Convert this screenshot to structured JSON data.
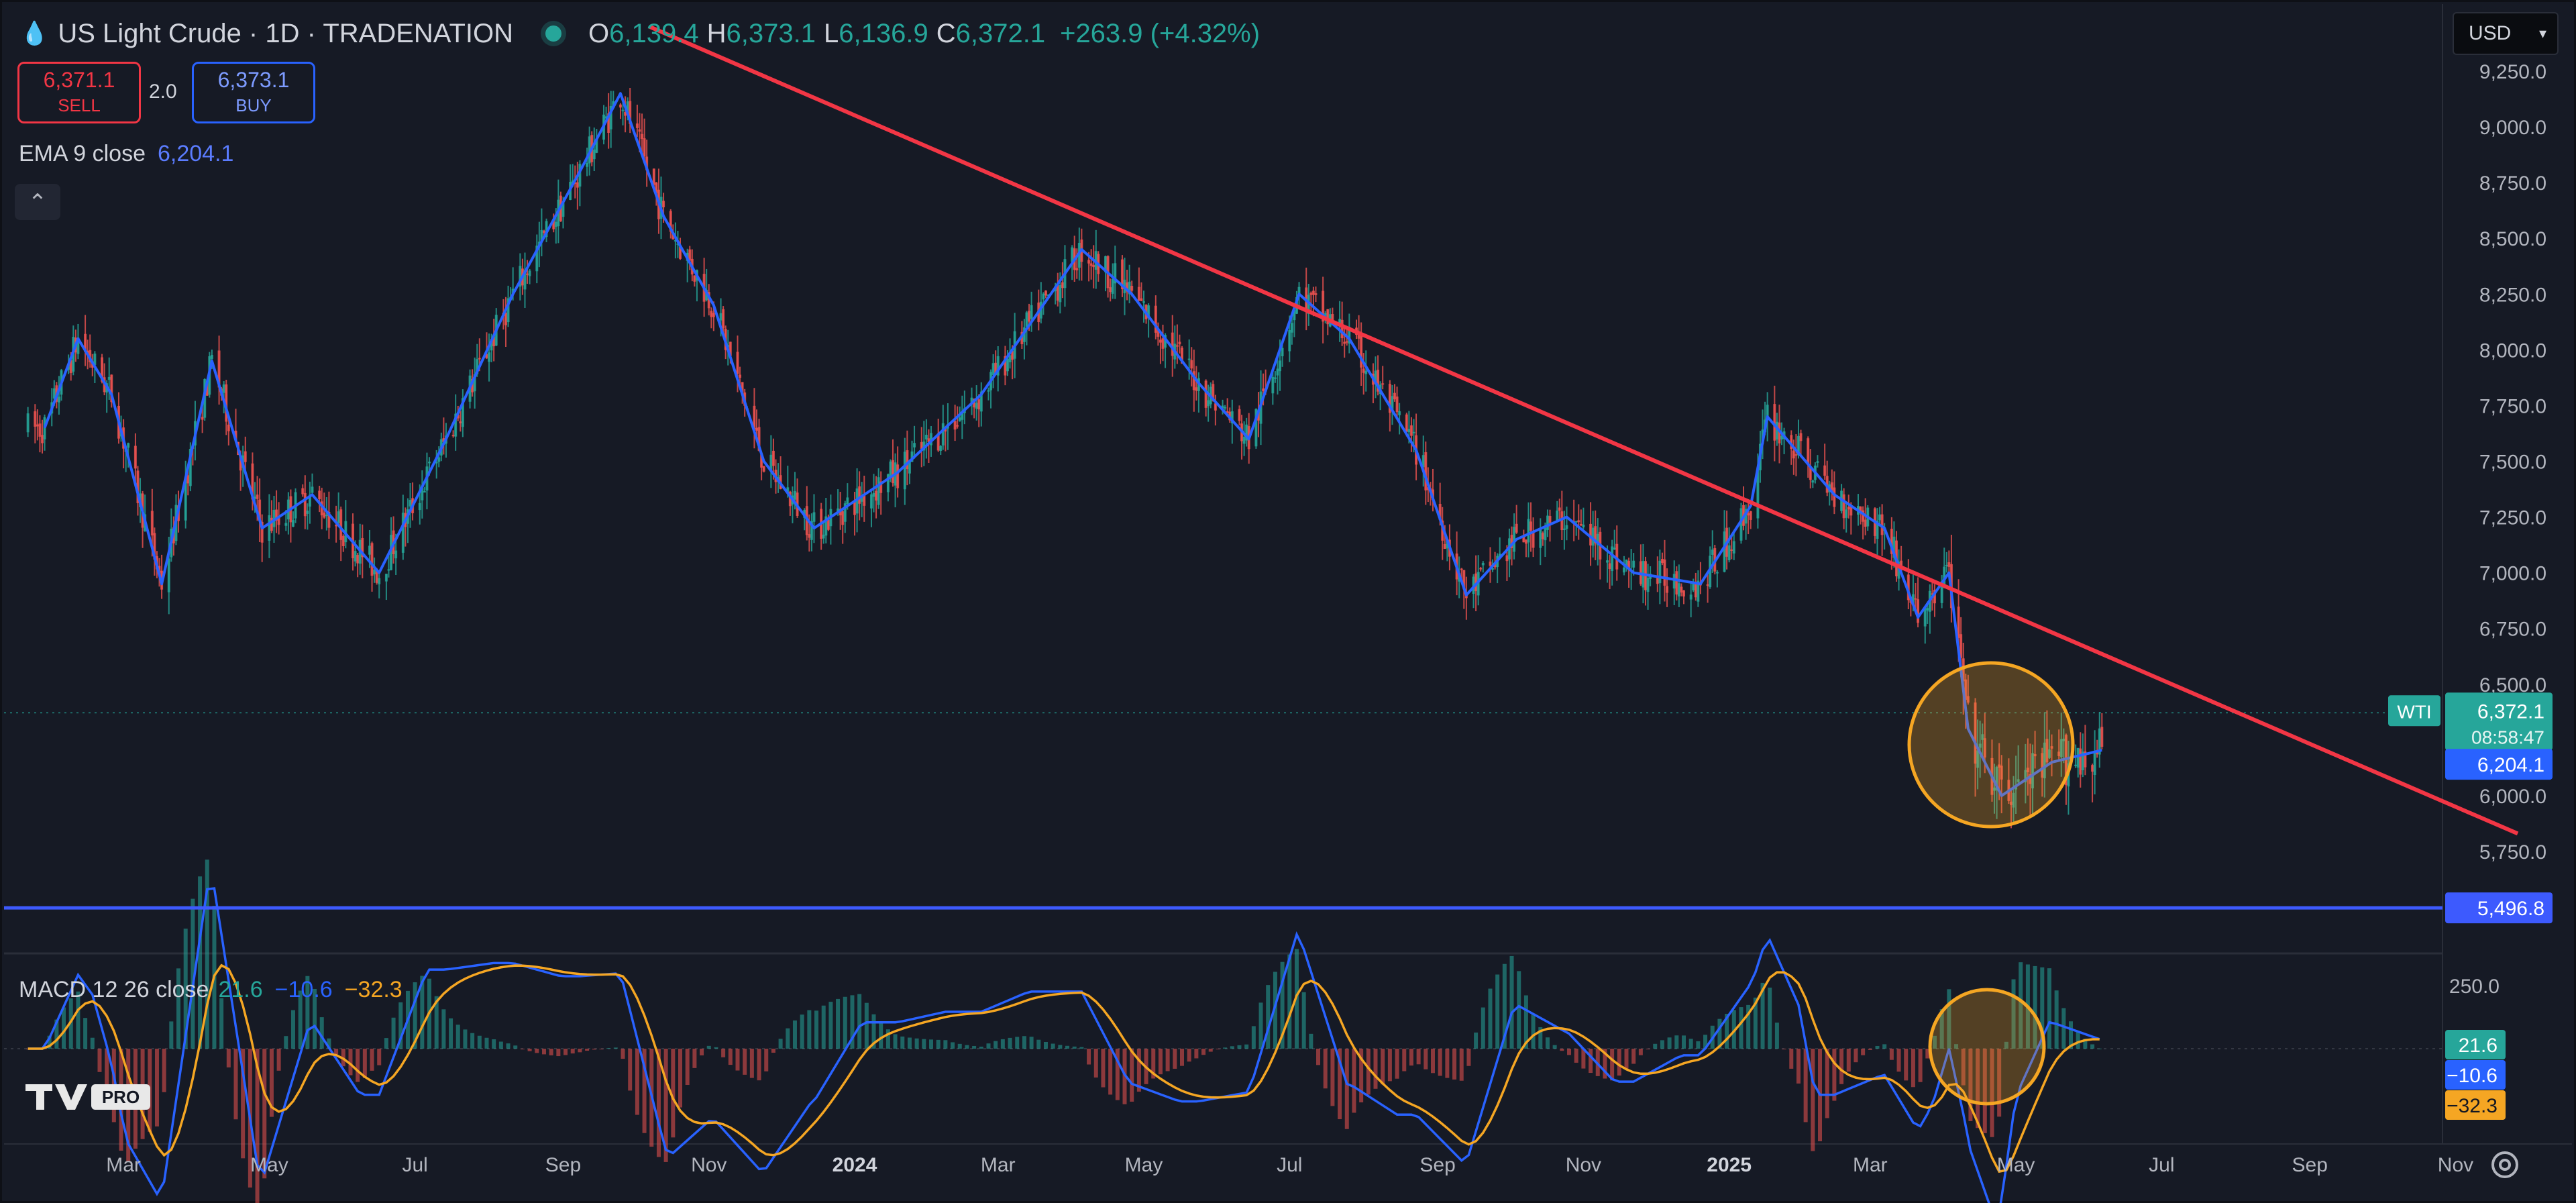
{
  "header": {
    "symbol": "US Light Crude · 1D · TRADENATION",
    "open_label": "O",
    "open": "6,139.4",
    "high_label": "H",
    "high": "6,373.1",
    "low_label": "L",
    "low": "6,136.9",
    "close_label": "C",
    "close": "6,372.1",
    "change": "+263.9 (+4.32%)"
  },
  "trade": {
    "sell_price": "6,371.1",
    "sell_label": "SELL",
    "quantity": "2.0",
    "buy_price": "6,373.1",
    "buy_label": "BUY"
  },
  "ema": {
    "label": "EMA 9 close",
    "value": "6,204.1"
  },
  "currency": "USD",
  "macd": {
    "label": "MACD 12 26 close",
    "macd": "21.6",
    "signal": "−10.6",
    "hist": "−32.3"
  },
  "price_tags": {
    "symbol_tag": "WTI",
    "last_price": "6,372.1",
    "countdown": "08:58:47",
    "ema_value": "6,204.1",
    "support_value": "5,496.8",
    "macd_tags": [
      "21.6",
      "−10.6",
      "−32.3"
    ]
  },
  "colors": {
    "background": "#161a25",
    "up": "#26a69a",
    "down": "#ef5350",
    "ema": "#2962ff",
    "trendline": "#f23645",
    "support": "#3d5afe",
    "circle": "#f5a623",
    "signal": "#f5a623"
  },
  "chart_data": {
    "type": "line",
    "title": "US Light Crude · 1D · TRADENATION",
    "y_axis_ticks": [
      "9,250.0",
      "9,000.0",
      "8,750.0",
      "8,500.0",
      "8,250.0",
      "8,000.0",
      "7,750.0",
      "7,500.0",
      "7,250.0",
      "7,000.0",
      "6,750.0",
      "6,500.0",
      "6,000.0",
      "5,750.0"
    ],
    "ylim": [
      5400,
      9330
    ],
    "x_axis_ticks": [
      "Mar",
      "May",
      "Jul",
      "Sep",
      "Nov",
      "2024",
      "Mar",
      "May",
      "Jul",
      "Sep",
      "Nov",
      "2025",
      "Mar",
      "May",
      "Jul",
      "Sep",
      "Nov"
    ],
    "series": [
      {
        "name": "EMA 9 close",
        "points": [
          [
            "2023-01-27",
            7650
          ],
          [
            "2023-02-10",
            8050
          ],
          [
            "2023-02-24",
            7800
          ],
          [
            "2023-03-17",
            6950
          ],
          [
            "2023-04-07",
            7950
          ],
          [
            "2023-04-28",
            7200
          ],
          [
            "2023-05-19",
            7350
          ],
          [
            "2023-06-16",
            7000
          ],
          [
            "2023-07-14",
            7600
          ],
          [
            "2023-08-11",
            8250
          ],
          [
            "2023-09-08",
            8800
          ],
          [
            "2023-09-25",
            9150
          ],
          [
            "2023-10-13",
            8600
          ],
          [
            "2023-11-03",
            8200
          ],
          [
            "2023-11-24",
            7500
          ],
          [
            "2023-12-15",
            7200
          ],
          [
            "2024-01-19",
            7450
          ],
          [
            "2024-02-23",
            7800
          ],
          [
            "2024-04-05",
            8450
          ],
          [
            "2024-04-26",
            8250
          ],
          [
            "2024-05-24",
            7850
          ],
          [
            "2024-06-14",
            7600
          ],
          [
            "2024-07-05",
            8250
          ],
          [
            "2024-07-26",
            8050
          ],
          [
            "2024-08-23",
            7550
          ],
          [
            "2024-09-13",
            6900
          ],
          [
            "2024-10-04",
            7150
          ],
          [
            "2024-10-25",
            7250
          ],
          [
            "2024-11-22",
            7000
          ],
          [
            "2024-12-20",
            6950
          ],
          [
            "2025-01-10",
            7300
          ],
          [
            "2025-01-17",
            7700
          ],
          [
            "2025-02-14",
            7350
          ],
          [
            "2025-03-07",
            7200
          ],
          [
            "2025-03-21",
            6800
          ],
          [
            "2025-04-03",
            7000
          ],
          [
            "2025-04-11",
            6300
          ],
          [
            "2025-04-25",
            6000
          ],
          [
            "2025-05-16",
            6150
          ],
          [
            "2025-06-06",
            6204.1
          ]
        ]
      }
    ],
    "annotations": {
      "resistance_trendline": {
        "from": [
          "2023-10-07",
          9450
        ],
        "to": [
          "2025-11-27",
          5830
        ]
      },
      "support_line": {
        "value": 5496.8
      },
      "last_price": 6372.1,
      "ema_last": 6204.1
    },
    "macd_panel": {
      "label": "MACD 12 26 close",
      "y_axis_ticks": [
        "250.0"
      ],
      "values": {
        "macd": 21.6,
        "signal": -10.6,
        "histogram": -32.3
      }
    },
    "xlabel": "",
    "ylabel": "",
    "grid": false,
    "legend": "top-left"
  }
}
